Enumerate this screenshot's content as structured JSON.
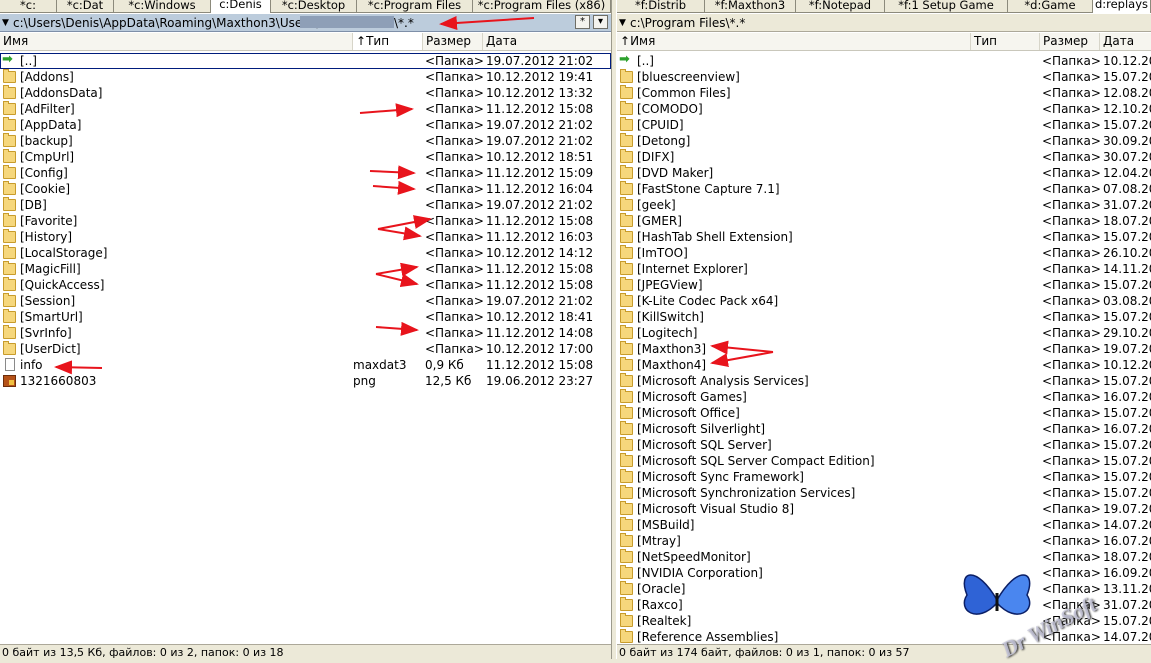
{
  "left": {
    "tabs": [
      "*c:",
      "*c:Dat",
      "*c:Windows",
      "c:Denis",
      "*c:Desktop",
      "*c:Program Files",
      "*c:Program Files (x86)"
    ],
    "active_tab": 3,
    "path": "c:\\Users\\Denis\\AppData\\Roaming\\Maxthon3\\Users\\",
    "path_suffix": "\\*.*",
    "buttons": {
      "star_label": "*",
      "history_label": "▾"
    },
    "columns": {
      "name": "Имя",
      "type": "Тип",
      "size": "Размер",
      "date": "Дата",
      "sort_indicator": "↑"
    },
    "rows": [
      {
        "icon": "up-arrow-icon",
        "name": "[..]",
        "type": "",
        "size": "<Папка>",
        "date": "19.07.2012 21:02"
      },
      {
        "icon": "folder-icon",
        "name": "[Addons]",
        "type": "",
        "size": "<Папка>",
        "date": "10.12.2012 19:41"
      },
      {
        "icon": "folder-icon",
        "name": "[AddonsData]",
        "type": "",
        "size": "<Папка>",
        "date": "10.12.2012 13:32"
      },
      {
        "icon": "folder-icon",
        "name": "[AdFilter]",
        "type": "",
        "size": "<Папка>",
        "date": "11.12.2012 15:08"
      },
      {
        "icon": "folder-icon",
        "name": "[AppData]",
        "type": "",
        "size": "<Папка>",
        "date": "19.07.2012 21:02"
      },
      {
        "icon": "folder-icon",
        "name": "[backup]",
        "type": "",
        "size": "<Папка>",
        "date": "19.07.2012 21:02"
      },
      {
        "icon": "folder-icon",
        "name": "[CmpUrl]",
        "type": "",
        "size": "<Папка>",
        "date": "10.12.2012 18:51"
      },
      {
        "icon": "folder-icon",
        "name": "[Config]",
        "type": "",
        "size": "<Папка>",
        "date": "11.12.2012 15:09"
      },
      {
        "icon": "folder-icon",
        "name": "[Cookie]",
        "type": "",
        "size": "<Папка>",
        "date": "11.12.2012 16:04"
      },
      {
        "icon": "folder-icon",
        "name": "[DB]",
        "type": "",
        "size": "<Папка>",
        "date": "19.07.2012 21:02"
      },
      {
        "icon": "folder-icon",
        "name": "[Favorite]",
        "type": "",
        "size": "<Папка>",
        "date": "11.12.2012 15:08"
      },
      {
        "icon": "folder-icon",
        "name": "[History]",
        "type": "",
        "size": "<Папка>",
        "date": "11.12.2012 16:03"
      },
      {
        "icon": "folder-icon",
        "name": "[LocalStorage]",
        "type": "",
        "size": "<Папка>",
        "date": "10.12.2012 14:12"
      },
      {
        "icon": "folder-icon",
        "name": "[MagicFill]",
        "type": "",
        "size": "<Папка>",
        "date": "11.12.2012 15:08"
      },
      {
        "icon": "folder-icon",
        "name": "[QuickAccess]",
        "type": "",
        "size": "<Папка>",
        "date": "11.12.2012 15:08"
      },
      {
        "icon": "folder-icon",
        "name": "[Session]",
        "type": "",
        "size": "<Папка>",
        "date": "19.07.2012 21:02"
      },
      {
        "icon": "folder-icon",
        "name": "[SmartUrl]",
        "type": "",
        "size": "<Папка>",
        "date": "10.12.2012 18:41"
      },
      {
        "icon": "folder-icon",
        "name": "[SvrInfo]",
        "type": "",
        "size": "<Папка>",
        "date": "11.12.2012 14:08"
      },
      {
        "icon": "folder-icon",
        "name": "[UserDict]",
        "type": "",
        "size": "<Папка>",
        "date": "10.12.2012 17:00"
      },
      {
        "icon": "file-icon",
        "name": "info",
        "type": "maxdat3",
        "size": "0,9 Кб",
        "date": "11.12.2012 15:08"
      },
      {
        "icon": "image-file-icon",
        "name": "1321660803",
        "type": "png",
        "size": "12,5 Кб",
        "date": "19.06.2012 23:27"
      }
    ],
    "status": "0 байт из 13,5 Кб, файлов: 0 из 2, папок: 0 из 18"
  },
  "right": {
    "tabs": [
      "*f:Distrib",
      "*f:Maxthon3",
      "*f:Notepad",
      "*f:1 Setup Game",
      "*d:Game",
      "d:replays"
    ],
    "active_tab": 5,
    "path": "c:\\Program Files\\*.*",
    "columns": {
      "name": "Имя",
      "type": "Тип",
      "size": "Размер",
      "date": "Дата"
    },
    "rows": [
      {
        "icon": "up-arrow-icon",
        "name": "[..]",
        "type": "",
        "size": "<Папка>",
        "date": "10.12.20"
      },
      {
        "icon": "folder-icon",
        "name": "[bluescreenview]",
        "type": "",
        "size": "<Папка>",
        "date": "15.07.20"
      },
      {
        "icon": "folder-icon",
        "name": "[Common Files]",
        "type": "",
        "size": "<Папка>",
        "date": "12.08.20"
      },
      {
        "icon": "folder-icon",
        "name": "[COMODO]",
        "type": "",
        "size": "<Папка>",
        "date": "12.10.20"
      },
      {
        "icon": "folder-icon",
        "name": "[CPUID]",
        "type": "",
        "size": "<Папка>",
        "date": "15.07.20"
      },
      {
        "icon": "folder-icon",
        "name": "[Detong]",
        "type": "",
        "size": "<Папка>",
        "date": "30.09.20"
      },
      {
        "icon": "folder-icon",
        "name": "[DIFX]",
        "type": "",
        "size": "<Папка>",
        "date": "30.07.20"
      },
      {
        "icon": "folder-icon",
        "name": "[DVD Maker]",
        "type": "",
        "size": "<Папка>",
        "date": "12.04.20"
      },
      {
        "icon": "folder-icon",
        "name": "[FastStone Capture 7.1]",
        "type": "",
        "size": "<Папка>",
        "date": "07.08.20"
      },
      {
        "icon": "folder-icon",
        "name": "[geek]",
        "type": "",
        "size": "<Папка>",
        "date": "31.07.20"
      },
      {
        "icon": "folder-icon",
        "name": "[GMER]",
        "type": "",
        "size": "<Папка>",
        "date": "18.07.20"
      },
      {
        "icon": "folder-icon",
        "name": "[HashTab Shell Extension]",
        "type": "",
        "size": "<Папка>",
        "date": "15.07.20"
      },
      {
        "icon": "folder-icon",
        "name": "[ImTOO]",
        "type": "",
        "size": "<Папка>",
        "date": "26.10.20"
      },
      {
        "icon": "folder-icon",
        "name": "[Internet Explorer]",
        "type": "",
        "size": "<Папка>",
        "date": "14.11.20"
      },
      {
        "icon": "folder-icon",
        "name": "[JPEGView]",
        "type": "",
        "size": "<Папка>",
        "date": "15.07.20"
      },
      {
        "icon": "folder-icon",
        "name": "[K-Lite Codec Pack x64]",
        "type": "",
        "size": "<Папка>",
        "date": "03.08.20"
      },
      {
        "icon": "folder-icon",
        "name": "[KillSwitch]",
        "type": "",
        "size": "<Папка>",
        "date": "15.07.20"
      },
      {
        "icon": "folder-icon",
        "name": "[Logitech]",
        "type": "",
        "size": "<Папка>",
        "date": "29.10.20"
      },
      {
        "icon": "folder-icon",
        "name": "[Maxthon3]",
        "type": "",
        "size": "<Папка>",
        "date": "19.07.20"
      },
      {
        "icon": "folder-icon",
        "name": "[Maxthon4]",
        "type": "",
        "size": "<Папка>",
        "date": "10.12.20"
      },
      {
        "icon": "folder-icon",
        "name": "[Microsoft Analysis Services]",
        "type": "",
        "size": "<Папка>",
        "date": "15.07.20"
      },
      {
        "icon": "folder-icon",
        "name": "[Microsoft Games]",
        "type": "",
        "size": "<Папка>",
        "date": "16.07.20"
      },
      {
        "icon": "folder-icon",
        "name": "[Microsoft Office]",
        "type": "",
        "size": "<Папка>",
        "date": "15.07.20"
      },
      {
        "icon": "folder-icon",
        "name": "[Microsoft Silverlight]",
        "type": "",
        "size": "<Папка>",
        "date": "16.07.20"
      },
      {
        "icon": "folder-icon",
        "name": "[Microsoft SQL Server]",
        "type": "",
        "size": "<Папка>",
        "date": "15.07.20"
      },
      {
        "icon": "folder-icon",
        "name": "[Microsoft SQL Server Compact Edition]",
        "type": "",
        "size": "<Папка>",
        "date": "15.07.20"
      },
      {
        "icon": "folder-icon",
        "name": "[Microsoft Sync Framework]",
        "type": "",
        "size": "<Папка>",
        "date": "15.07.20"
      },
      {
        "icon": "folder-icon",
        "name": "[Microsoft Synchronization Services]",
        "type": "",
        "size": "<Папка>",
        "date": "15.07.20"
      },
      {
        "icon": "folder-icon",
        "name": "[Microsoft Visual Studio 8]",
        "type": "",
        "size": "<Папка>",
        "date": "19.07.20"
      },
      {
        "icon": "folder-icon",
        "name": "[MSBuild]",
        "type": "",
        "size": "<Папка>",
        "date": "14.07.20"
      },
      {
        "icon": "folder-icon",
        "name": "[Mtray]",
        "type": "",
        "size": "<Папка>",
        "date": "16.07.20"
      },
      {
        "icon": "folder-icon",
        "name": "[NetSpeedMonitor]",
        "type": "",
        "size": "<Папка>",
        "date": "18.07.20"
      },
      {
        "icon": "folder-icon",
        "name": "[NVIDIA Corporation]",
        "type": "",
        "size": "<Папка>",
        "date": "16.09.20"
      },
      {
        "icon": "folder-icon",
        "name": "[Oracle]",
        "type": "",
        "size": "<Папка>",
        "date": "13.11.20"
      },
      {
        "icon": "folder-icon",
        "name": "[Raxco]",
        "type": "",
        "size": "<Папка>",
        "date": "31.07.20"
      },
      {
        "icon": "folder-icon",
        "name": "[Realtek]",
        "type": "",
        "size": "<Папка>",
        "date": "15.07.20"
      },
      {
        "icon": "folder-icon",
        "name": "[Reference Assemblies]",
        "type": "",
        "size": "<Папка>",
        "date": "14.07.20"
      }
    ],
    "status": "0 байт из 174 байт, файлов: 0 из 1, папок: 0 из 57"
  },
  "watermark": "Dr Win Soft",
  "colors": {
    "annotation_arrow": "#e8141c",
    "path_bar": "#bcccdc",
    "folder": "#f6d77c"
  }
}
